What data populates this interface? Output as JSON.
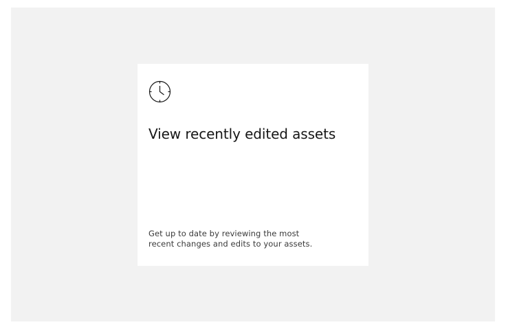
{
  "card": {
    "icon": "clock-icon",
    "title": "View recently edited assets",
    "description": "Get up to date by reviewing the most recent changes and edits to your assets."
  },
  "colors": {
    "background_panel": "#f2f2f2",
    "card_background": "#ffffff",
    "title_text": "#161616",
    "body_text": "#393939"
  }
}
